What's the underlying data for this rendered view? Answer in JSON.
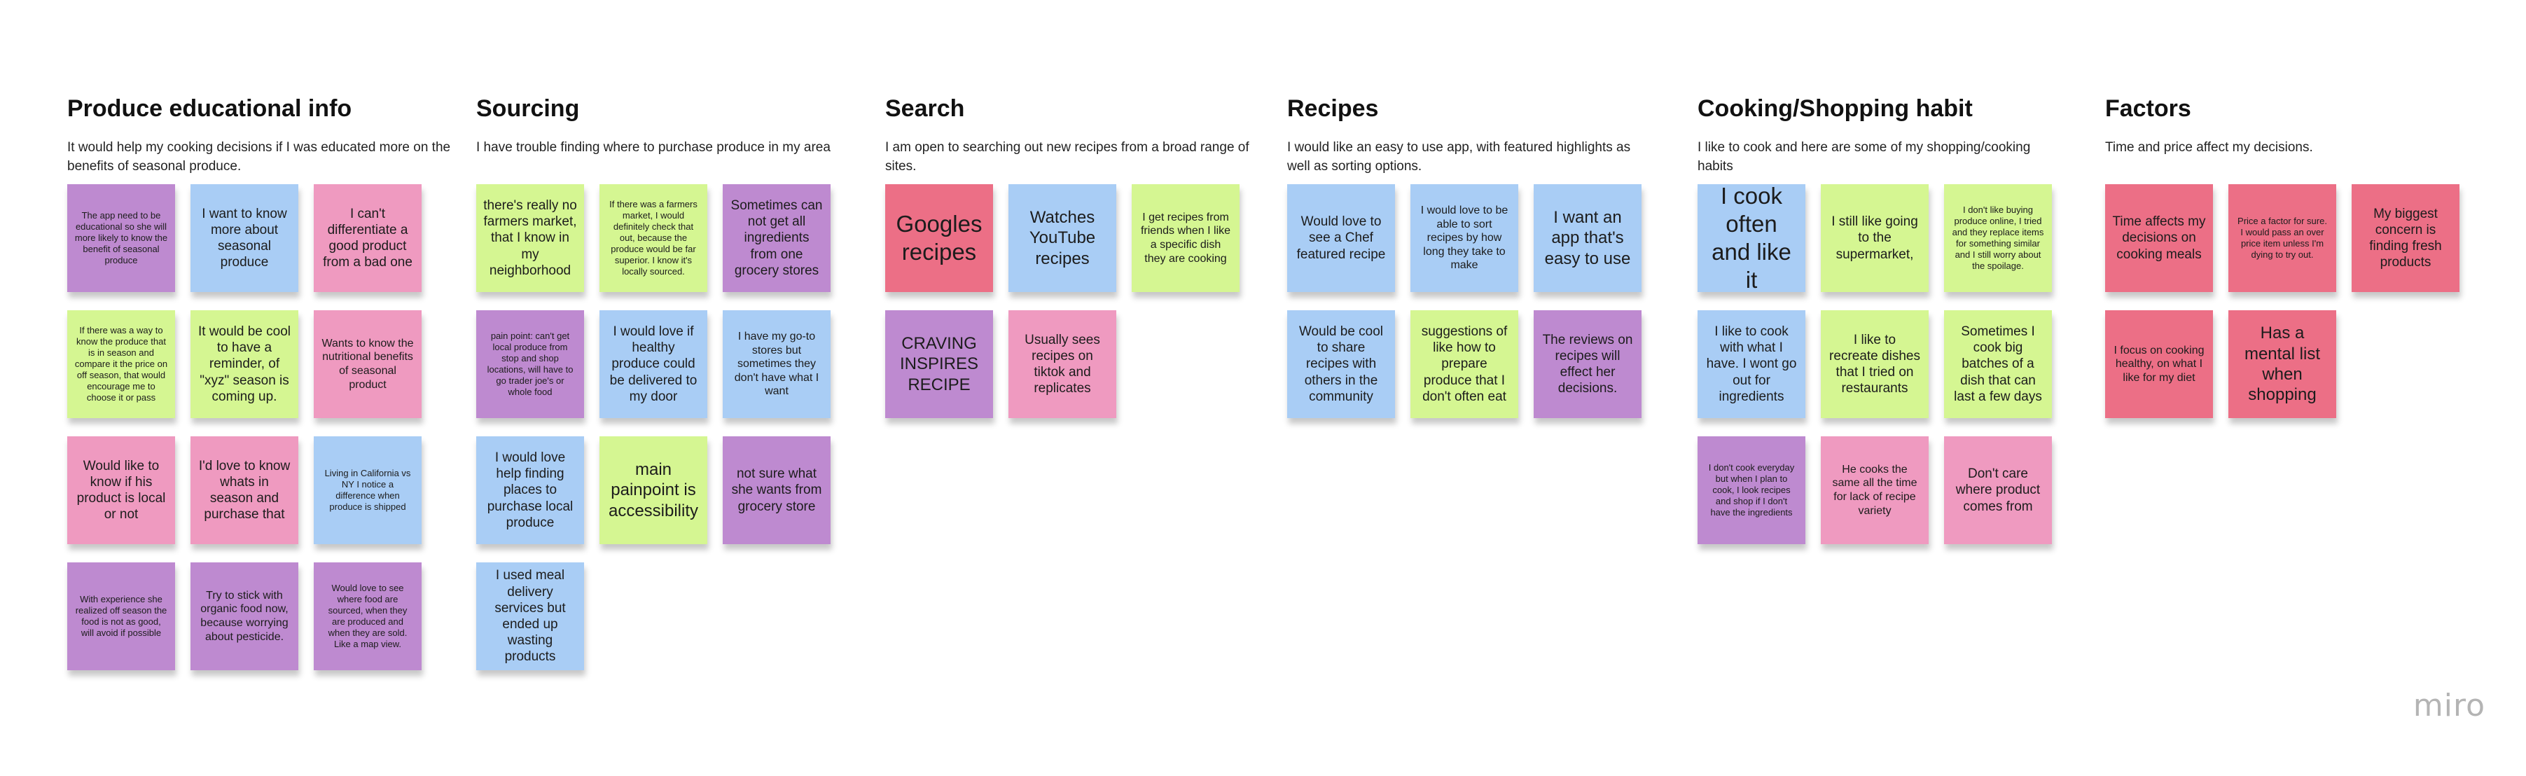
{
  "brand": {
    "logo_text": "miro"
  },
  "columns": [
    {
      "title": "Produce educational info",
      "description": "It would help my cooking decisions if I was  educated more on the benefits of seasonal produce.",
      "notes": [
        {
          "text": "The app need to be educational so she will more likely to know the benefit of seasonal produce",
          "color": "purple"
        },
        {
          "text": "I want to know more about seasonal produce",
          "color": "blue"
        },
        {
          "text": "I can't differentiate a good product from a  bad one",
          "color": "pink"
        },
        {
          "text": "If there was a way to know the produce that is in season and compare it the price on off season, that would encourage me to choose it or pass",
          "color": "green"
        },
        {
          "text": "It would be cool to have a reminder, of \"xyz\" season is coming up.",
          "color": "green"
        },
        {
          "text": "Wants to know the nutritional benefits of seasonal product",
          "color": "pink"
        },
        {
          "text": "Would like to know if his product is local or not",
          "color": "pink"
        },
        {
          "text": "I'd love to know whats in season and purchase that",
          "color": "pink"
        },
        {
          "text": "Living in California vs NY I notice a difference when produce is shipped",
          "color": "blue"
        },
        {
          "text": "With experience she realized off season the food is not as good, will avoid if possible",
          "color": "purple"
        },
        {
          "text": "Try to stick with organic food now, because worrying about pesticide.",
          "color": "purple"
        },
        {
          "text": "Would love to see where food are sourced,  when they are produced and when they are sold. Like a map view.",
          "color": "purple"
        }
      ]
    },
    {
      "title": "Sourcing",
      "description": "I have trouble finding where to purchase produce in my area",
      "notes": [
        {
          "text": "there's really no farmers market, that I know in my neighborhood",
          "color": "green"
        },
        {
          "text": "If there was a farmers market,  I would definitely check that out, because the produce would be far superior. I know it's locally sourced.",
          "color": "green"
        },
        {
          "text": "Sometimes can not get all ingredients from one grocery stores",
          "color": "purple"
        },
        {
          "text": "pain point: can't get local produce from stop and shop locations, will have to go trader joe's or whole food",
          "color": "purple"
        },
        {
          "text": "I would love if healthy produce could be delivered to my door",
          "color": "blue"
        },
        {
          "text": "I have my go-to stores but sometimes they don't have what I want",
          "color": "blue"
        },
        {
          "text": "I would love help finding places to purchase local produce",
          "color": "blue"
        },
        {
          "text": "main painpoint is accessibility",
          "color": "green"
        },
        {
          "text": "not sure what she wants from grocery store",
          "color": "purple"
        },
        {
          "text": "I used meal delivery services but ended up wasting products",
          "color": "blue"
        }
      ]
    },
    {
      "title": "Search",
      "description": "I am open to searching out new recipes from a broad range of sites.",
      "notes": [
        {
          "text": "Googles recipes",
          "color": "red"
        },
        {
          "text": "Watches YouTube recipes",
          "color": "blue"
        },
        {
          "text": "I get recipes from friends when I like a specific dish they are cooking",
          "color": "green"
        },
        {
          "text": "CRAVING INSPIRES RECIPE",
          "color": "purple"
        },
        {
          "text": "Usually sees recipes on tiktok and replicates",
          "color": "pink"
        }
      ]
    },
    {
      "title": "Recipes",
      "description": " I would like an easy to use app, with featured highlights as well as sorting options.",
      "notes": [
        {
          "text": "Would love to see a Chef featured recipe",
          "color": "blue"
        },
        {
          "text": "I would love to be able to sort recipes by how long they take to make",
          "color": "blue"
        },
        {
          "text": "I want an app that's easy to use",
          "color": "blue"
        },
        {
          "text": "Would be cool to share recipes with others in the community",
          "color": "blue"
        },
        {
          "text": "suggestions of like how to prepare produce that I don't often eat",
          "color": "green"
        },
        {
          "text": "The reviews on recipes will effect her decisions.",
          "color": "purple"
        }
      ]
    },
    {
      "title": "Cooking/Shopping habit",
      "description": "I like to cook and here are some of my shopping/cooking habits",
      "notes": [
        {
          "text": "I cook often and like it",
          "color": "blue"
        },
        {
          "text": "I still like going to the supermarket,",
          "color": "green"
        },
        {
          "text": "I don't like buying produce online, I tried and they replace items for something similar and I still worry about the spoilage.",
          "color": "green"
        },
        {
          "text": "I like to cook with what I have. I wont go out for ingredients",
          "color": "blue"
        },
        {
          "text": "I like to recreate dishes that I tried on restaurants",
          "color": "green"
        },
        {
          "text": "Sometimes I cook big batches of a dish that can last a few days",
          "color": "green"
        },
        {
          "text": "I don't cook everyday but when I plan to cook, I look recipes and shop if I don't have the ingredients",
          "color": "purple"
        },
        {
          "text": "He cooks the same all the time for lack of recipe variety",
          "color": "pink"
        },
        {
          "text": "Don't care where product comes from",
          "color": "pink"
        }
      ]
    },
    {
      "title": "Factors",
      "description": "Time and price affect my decisions.",
      "notes": [
        {
          "text": "Time affects my decisions on cooking meals",
          "color": "red"
        },
        {
          "text": "Price  a factor for sure. I would pass an over price item unless I'm dying to try out.",
          "color": "red"
        },
        {
          "text": "My biggest concern is finding fresh products",
          "color": "red"
        },
        {
          "text": "I focus on cooking healthy, on what I like for my diet",
          "color": "red"
        },
        {
          "text": "Has a mental list when shopping",
          "color": "red"
        }
      ]
    }
  ]
}
